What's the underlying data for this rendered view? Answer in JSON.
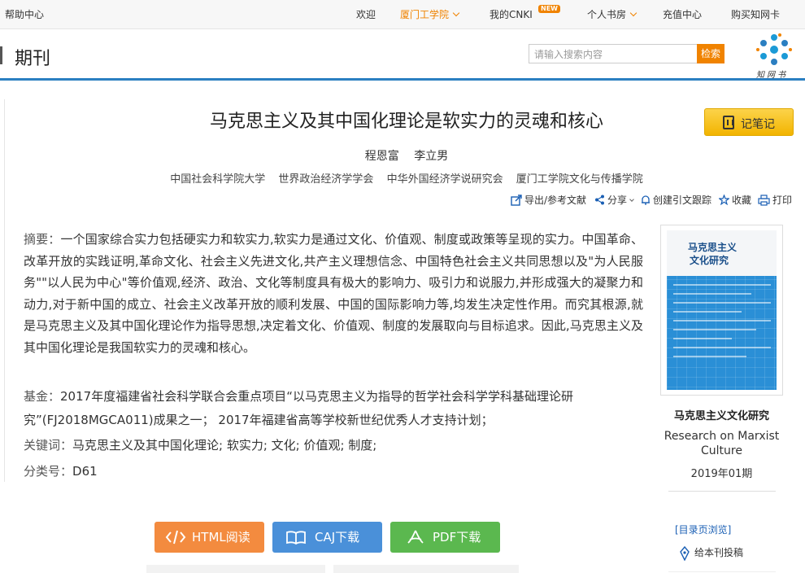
{
  "topbar": {
    "help": "帮助中心",
    "nav": [
      "欢迎",
      "厦门工学院",
      "我的CNKI",
      "个人书房",
      "充值中心",
      "购买知网卡"
    ],
    "new_badge": "NEW"
  },
  "header": {
    "section_title": "期刊",
    "search_placeholder": "请输入搜索内容",
    "search_button": "检索",
    "logo_text": "知网书"
  },
  "article": {
    "title": "马克思主义及其中国化理论是软实力的灵魂和核心",
    "note_button": "记笔记",
    "authors": [
      "程恩富",
      "李立男"
    ],
    "orgs": [
      "中国社会科学院大学",
      "世界政治经济学学会",
      "中华外国经济学说研究会",
      "厦门工学院文化与传播学院"
    ],
    "tools": [
      "导出/参考文献",
      "分享",
      "创建引文跟踪",
      "收藏",
      "打印"
    ],
    "abstract_label": "摘要：",
    "abstract": "一个国家综合实力包括硬实力和软实力,软实力是通过文化、价值观、制度或政策等呈现的实力。中国革命、改革开放的实践证明,革命文化、社会主义先进文化,共产主义理想信念、中国特色社会主义共同思想以及\"为人民服务\"\"以人民为中心\"等价值观,经济、政治、文化等制度具有极大的影响力、吸引力和说服力,并形成强大的凝聚力和动力,对于新中国的成立、社会主义改革开放的顺利发展、中国的国际影响力等,均发生决定性作用。而究其根源,就是马克思主义及其中国化理论作为指导思想,决定着文化、价值观、制度的发展取向与目标追求。因此,马克思主义及其中国化理论是我国软实力的灵魂和核心。",
    "fund_label": "基金：",
    "fund": "2017年度福建省社会科学联合会重点项目“以马克思主义为指导的哲学社会科学学科基础理论研究”(FJ2018MGCA011)成果之一； 2017年福建省高等学校新世纪优秀人才支持计划；",
    "keywords_label": "关键词：",
    "keywords": "马克思主义及其中国化理论; 软实力; 文化; 价值观; 制度;",
    "class_label": "分类号：",
    "class_code": "D61"
  },
  "downloads": {
    "html": "HTML阅读",
    "caj": "CAJ下载",
    "pdf": "PDF下载"
  },
  "journal": {
    "cover_title_1": "马克思主义",
    "cover_title_2": "文化研究",
    "name": "马克思主义文化研究",
    "name_en": "Research on Marxist Culture",
    "issue": "2019年01期",
    "toc_link": "[目录页浏览]",
    "submit": "给本刊投稿"
  },
  "colors": {
    "accent_orange": "#f08300",
    "header_rule": "#2b7fc1",
    "html_button": "#f38b3f",
    "caj_button": "#4a90d9",
    "pdf_button": "#5bb84f",
    "note_button": "#f7c21e"
  }
}
